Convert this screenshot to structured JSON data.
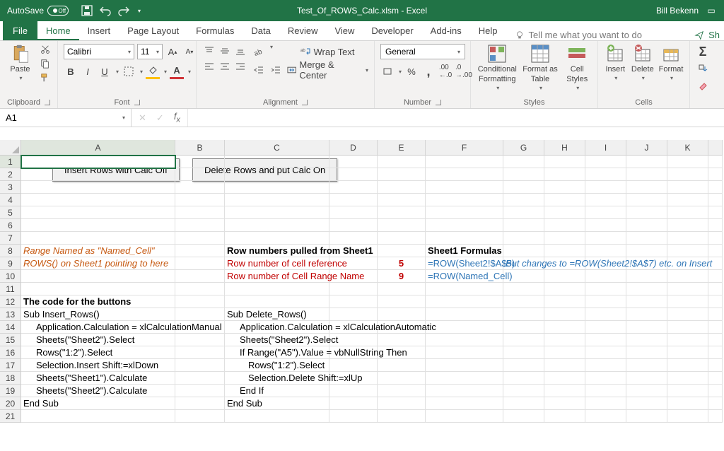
{
  "titlebar": {
    "autosave": "AutoSave",
    "autosave_state": "Off",
    "filename": "Test_Of_ROWS_Calc.xlsm  -  Excel",
    "user": "Bill Bekenn"
  },
  "tabs": {
    "file": "File",
    "home": "Home",
    "insert": "Insert",
    "page_layout": "Page Layout",
    "formulas": "Formulas",
    "data": "Data",
    "review": "Review",
    "view": "View",
    "developer": "Developer",
    "addins": "Add-ins",
    "help": "Help",
    "tell_me": "Tell me what you want to do",
    "share": "Sh"
  },
  "ribbon": {
    "clipboard": {
      "label": "Clipboard",
      "paste": "Paste"
    },
    "font": {
      "label": "Font",
      "name": "Calibri",
      "size": "11",
      "bold": "B",
      "italic": "I",
      "underline": "U"
    },
    "alignment": {
      "label": "Alignment",
      "wrap": "Wrap Text",
      "merge": "Merge & Center"
    },
    "number": {
      "label": "Number",
      "format": "General"
    },
    "styles": {
      "label": "Styles",
      "cond": "Conditional",
      "cond2": "Formatting",
      "fmt_table": "Format as",
      "fmt_table2": "Table",
      "cell_styles": "Cell",
      "cell_styles2": "Styles"
    },
    "cells": {
      "label": "Cells",
      "insert": "Insert",
      "delete": "Delete",
      "format": "Format"
    },
    "editing": {
      "label": ""
    }
  },
  "formula_bar": {
    "name_box": "A1",
    "formula": ""
  },
  "columns": [
    "A",
    "B",
    "C",
    "D",
    "E",
    "F",
    "G",
    "H",
    "I",
    "J",
    "K"
  ],
  "sheet_buttons": {
    "insert": "Insert Rows with Calc Off",
    "delete": "Delete Rows and put Calc On"
  },
  "cells": {
    "r8": {
      "A": "Range Named as \"Named_Cell\"",
      "C": "Row numbers pulled from Sheet1",
      "F": "Sheet1 Formulas"
    },
    "r9": {
      "A": "ROWS() on Sheet1 pointing to here",
      "C": "Row number of cell reference",
      "E": "5",
      "F": "=ROW(Sheet2!$A$5)",
      "G": "But changes to =ROW(Sheet2!$A$7) etc. on Insert"
    },
    "r10": {
      "C": "Row number of Cell Range Name",
      "E": "9",
      "F": "=ROW(Named_Cell)"
    },
    "r12": {
      "A": "The code for the buttons"
    },
    "r13": {
      "A": "Sub Insert_Rows()",
      "C": "Sub Delete_Rows()"
    },
    "r14": {
      "A": "Application.Calculation = xlCalculationManual",
      "C": "Application.Calculation = xlCalculationAutomatic"
    },
    "r15": {
      "A": "Sheets(\"Sheet2\").Select",
      "C": "Sheets(\"Sheet2\").Select"
    },
    "r16": {
      "A": "Rows(\"1:2\").Select",
      "C": "If Range(\"A5\").Value = vbNullString Then"
    },
    "r17": {
      "A": "Selection.Insert Shift:=xlDown",
      "C": "Rows(\"1:2\").Select"
    },
    "r18": {
      "A": "Sheets(\"Sheet1\").Calculate",
      "C": "Selection.Delete Shift:=xlUp"
    },
    "r19": {
      "A": "Sheets(\"Sheet2\").Calculate",
      "C": "End If"
    },
    "r20": {
      "A": "End Sub",
      "C": "End Sub"
    }
  }
}
